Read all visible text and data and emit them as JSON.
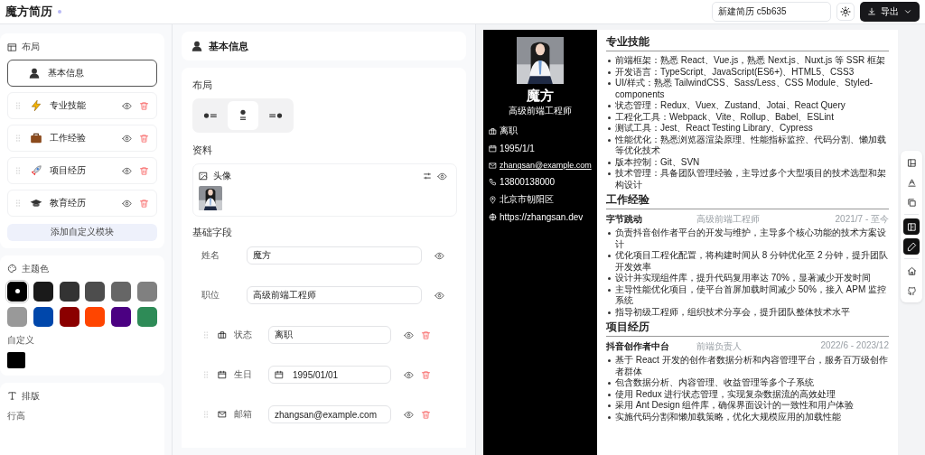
{
  "app": {
    "title": "魔方简历",
    "document_name": "新建简历 c5b635",
    "export_label": "导出"
  },
  "layout_panel": {
    "title": "布局",
    "modules": [
      {
        "kind": "fixed",
        "label": "基本信息",
        "selected": true
      },
      {
        "kind": "module",
        "label": "专业技能",
        "selected": false
      },
      {
        "kind": "module",
        "label": "工作经验",
        "selected": false
      },
      {
        "kind": "module",
        "label": "项目经历",
        "selected": false
      },
      {
        "kind": "module",
        "label": "教育经历",
        "selected": false
      }
    ],
    "add_label": "添加自定义模块"
  },
  "theme_panel": {
    "title": "主题色",
    "swatches": [
      {
        "color": "#000000",
        "selected": true
      },
      {
        "color": "#1a1a1a",
        "selected": false
      },
      {
        "color": "#333333",
        "selected": false
      },
      {
        "color": "#4d4d4d",
        "selected": false
      },
      {
        "color": "#666666",
        "selected": false
      },
      {
        "color": "#808080",
        "selected": false
      },
      {
        "color": "#999999",
        "selected": false
      },
      {
        "color": "#0047ab",
        "selected": false
      },
      {
        "color": "#8b0000",
        "selected": false
      },
      {
        "color": "#ff4500",
        "selected": false
      },
      {
        "color": "#4b0082",
        "selected": false
      },
      {
        "color": "#2e8b57",
        "selected": false
      }
    ],
    "custom_label": "自定义",
    "custom_swatch": {
      "color": "#000000"
    }
  },
  "typography_panel": {
    "title": "排版",
    "line_height_label": "行高"
  },
  "editor": {
    "title": "基本信息",
    "layout_label": "布局",
    "layout_options": [
      {
        "kind": "left",
        "selected": false
      },
      {
        "kind": "center",
        "selected": true
      },
      {
        "kind": "right",
        "selected": false
      }
    ],
    "profile_label": "资料",
    "avatar_label": "头像",
    "fields_label": "基础字段",
    "fields": [
      {
        "kind": "fixed",
        "label": "姓名",
        "value": "魔方"
      },
      {
        "kind": "fixed",
        "label": "职位",
        "value": "高级前端工程师"
      },
      {
        "kind": "custom",
        "label": "状态",
        "value": "离职"
      },
      {
        "kind": "custom",
        "label": "生日",
        "value": "1995/01/01"
      },
      {
        "kind": "custom",
        "label": "邮箱",
        "value": "zhangsan@example.com"
      }
    ]
  },
  "preview": {
    "name": "魔方",
    "title": "高级前端工程师",
    "contacts": [
      {
        "text": "离职",
        "link": false
      },
      {
        "text": "1995/1/1",
        "link": false
      },
      {
        "text": "zhangsan@example.com",
        "link": true
      },
      {
        "text": "13800138000",
        "link": false
      },
      {
        "text": "北京市朝阳区",
        "link": false
      },
      {
        "text": "https://zhangsan.dev",
        "link": false
      }
    ],
    "skills": {
      "title": "专业技能",
      "items": [
        "前端框架：熟悉 React、Vue.js，熟悉 Next.js、Nuxt.js 等 SSR 框架",
        "开发语言：TypeScript、JavaScript(ES6+)、HTML5、CSS3",
        "UI/样式：熟悉 TailwindCSS、Sass/Less、CSS Module、Styled-components",
        "状态管理：Redux、Vuex、Zustand、Jotai、React Query",
        "工程化工具：Webpack、Vite、Rollup、Babel、ESLint",
        "测试工具：Jest、React Testing Library、Cypress",
        "性能优化：熟悉浏览器渲染原理、性能指标监控、代码分割、懒加载等优化技术",
        "版本控制：Git、SVN",
        "技术管理：具备团队管理经验，主导过多个大型项目的技术选型和架构设计"
      ]
    },
    "experience": {
      "title": "工作经验",
      "entries": [
        {
          "org": "字节跳动",
          "role": "高级前端工程师",
          "period": "2021/7 - 至今",
          "items": [
            "负责抖音创作者平台的开发与维护，主导多个核心功能的技术方案设计",
            "优化项目工程化配置，将构建时间从 8 分钟优化至 2 分钟，提升团队开发效率",
            "设计并实现组件库，提升代码复用率达 70%，显著减少开发时间",
            "主导性能优化项目，使平台首屏加载时间减少 50%，接入 APM 监控系统",
            "指导初级工程师，组织技术分享会，提升团队整体技术水平"
          ]
        }
      ]
    },
    "projects": {
      "title": "项目经历",
      "entries": [
        {
          "org": "抖音创作者中台",
          "role": "前端负责人",
          "period": "2022/6 - 2023/12",
          "items": [
            "基于 React 开发的创作者数据分析和内容管理平台，服务百万级创作者群体",
            "包含数据分析、内容管理、收益管理等多个子系统",
            "使用 Redux 进行状态管理，实现复杂数据流的高效处理",
            "采用 Ant Design 组件库，确保界面设计的一致性和用户体验",
            "实施代码分割和懒加载策略，优化大规模应用的加载性能"
          ]
        }
      ]
    }
  },
  "toolbar": {
    "groups": [
      {
        "items": [
          {
            "selected": false
          },
          {
            "selected": false
          },
          {
            "selected": false
          }
        ]
      },
      {
        "items": [
          {
            "selected": true
          },
          {
            "selected": true
          }
        ]
      },
      {
        "items": [
          {
            "selected": false
          },
          {
            "selected": false
          }
        ]
      }
    ]
  }
}
